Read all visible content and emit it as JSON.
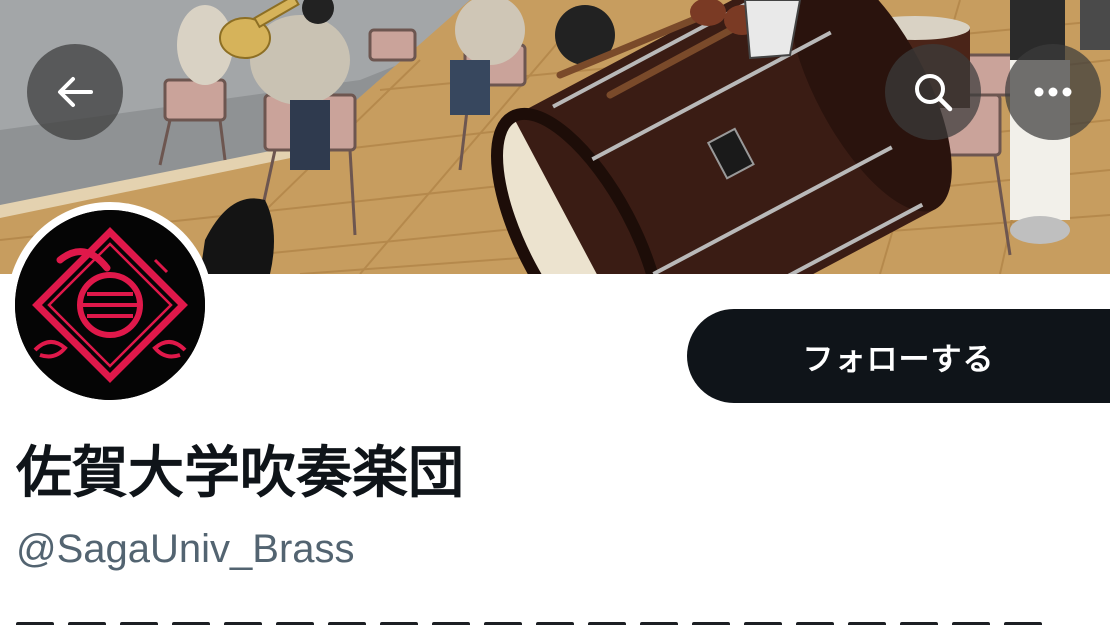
{
  "header": {
    "back_icon": "arrow-left-icon",
    "search_icon": "search-icon",
    "more_icon": "more-horizontal-icon",
    "button_bg": "#3c3c3c"
  },
  "banner": {
    "description_colors": {
      "floor": "#c9a46a",
      "drum_body": "#3a1c14",
      "drum_head": "#e8dcc6"
    }
  },
  "profile": {
    "display_name": "佐賀大学吹奏楽団",
    "handle": "@SagaUniv_Brass",
    "avatar_colors": {
      "background": "#050505",
      "emblem": "#e0184a"
    }
  },
  "actions": {
    "follow_label": "フォローする",
    "follow_bg": "#0f1419",
    "follow_text_color": "#ffffff"
  }
}
